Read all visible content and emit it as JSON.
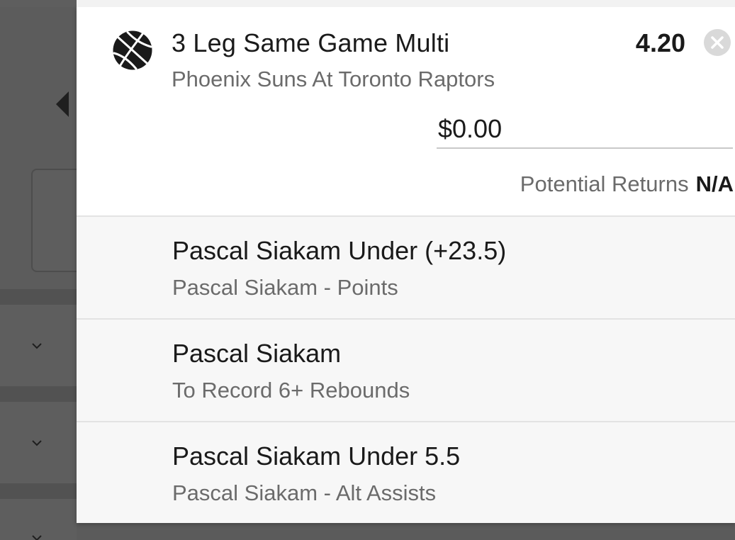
{
  "bet_slip": {
    "title": "3 Leg Same Game Multi",
    "event": "Phoenix Suns At Toronto Raptors",
    "odds": "4.20",
    "sport_icon": "basketball-icon",
    "remove_icon": "close-circle-icon",
    "stake": {
      "value": "$0.00",
      "placeholder": ""
    },
    "potential_returns": {
      "label": "Potential Returns",
      "value": "N/A"
    },
    "legs": [
      {
        "title": "Pascal Siakam Under (+23.5)",
        "subtitle": "Pascal Siakam - Points"
      },
      {
        "title": "Pascal Siakam",
        "subtitle": "To Record 6+ Rebounds"
      },
      {
        "title": "Pascal Siakam Under 5.5",
        "subtitle": "Pascal Siakam - Alt Assists"
      }
    ]
  },
  "background_page": {
    "collapse_icon": "triangle-left-icon",
    "expand_icon": "chevron-down-icon"
  },
  "colors": {
    "text_primary": "#1a1a1a",
    "text_secondary": "#6b6b6b",
    "overlay_dim": "#5c5c5c",
    "leg_background": "#f7f7f7",
    "close_button": "#d9d9d9"
  }
}
